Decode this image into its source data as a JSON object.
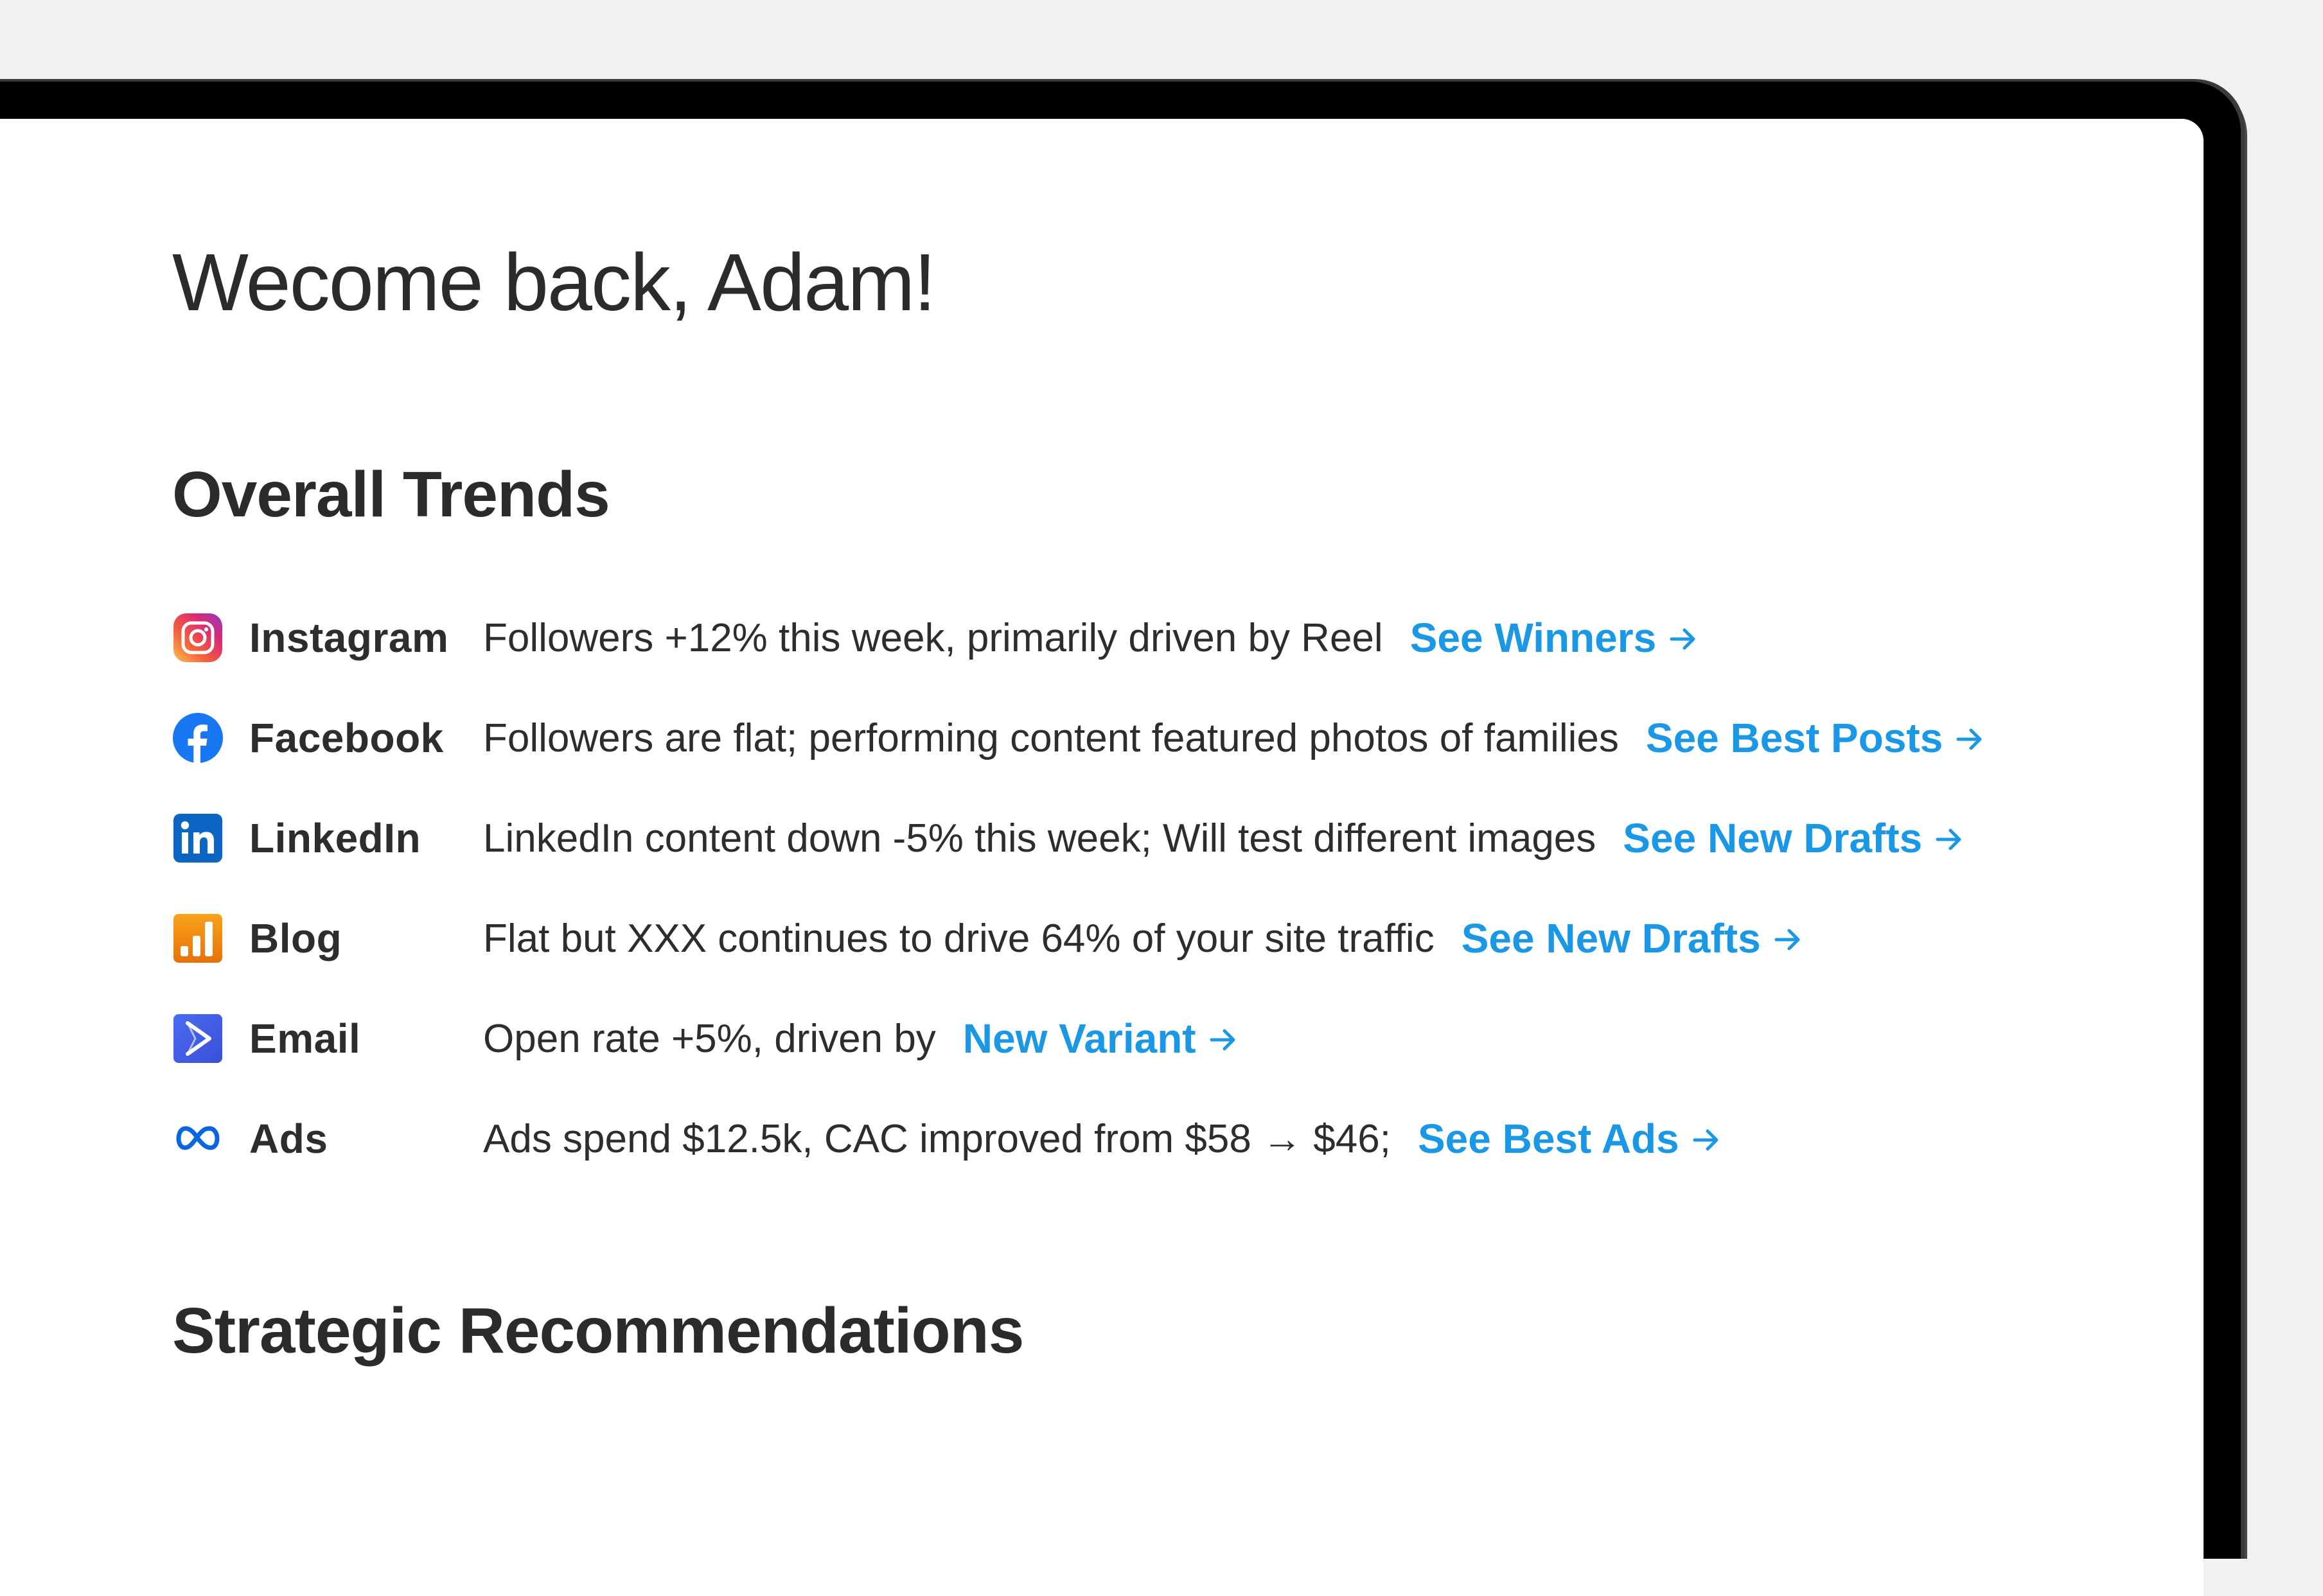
{
  "greeting": "Wecome back, Adam!",
  "sections": {
    "trends_title": "Overall Trends",
    "recommendations_title": "Strategic Recommendations"
  },
  "trends": [
    {
      "channel": "Instagram",
      "icon": "instagram-icon",
      "description": "Followers +12% this week, primarily driven by Reel",
      "link": "See Winners"
    },
    {
      "channel": "Facebook",
      "icon": "facebook-icon",
      "description": "Followers are flat; performing content featured photos of families",
      "link": "See Best Posts"
    },
    {
      "channel": "LinkedIn",
      "icon": "linkedin-icon",
      "description": "LinkedIn content down -5% this week; Will test different images",
      "link": "See New Drafts"
    },
    {
      "channel": "Blog",
      "icon": "blog-chart-icon",
      "description": "Flat but XXX continues to drive 64% of your site traffic",
      "link": "See New Drafts"
    },
    {
      "channel": "Email",
      "icon": "email-send-icon",
      "description": "Open rate +5%, driven by",
      "link": "New Variant"
    },
    {
      "channel": "Ads",
      "icon": "meta-infinity-icon",
      "description": "Ads spend $12.5k, CAC improved from $58 → $46;",
      "link": "See Best Ads"
    }
  ],
  "colors": {
    "link": "#1a98e6",
    "text": "#2d2d2f",
    "background": "#f1f1f2",
    "screen": "#ffffff",
    "bezel": "#000000"
  }
}
